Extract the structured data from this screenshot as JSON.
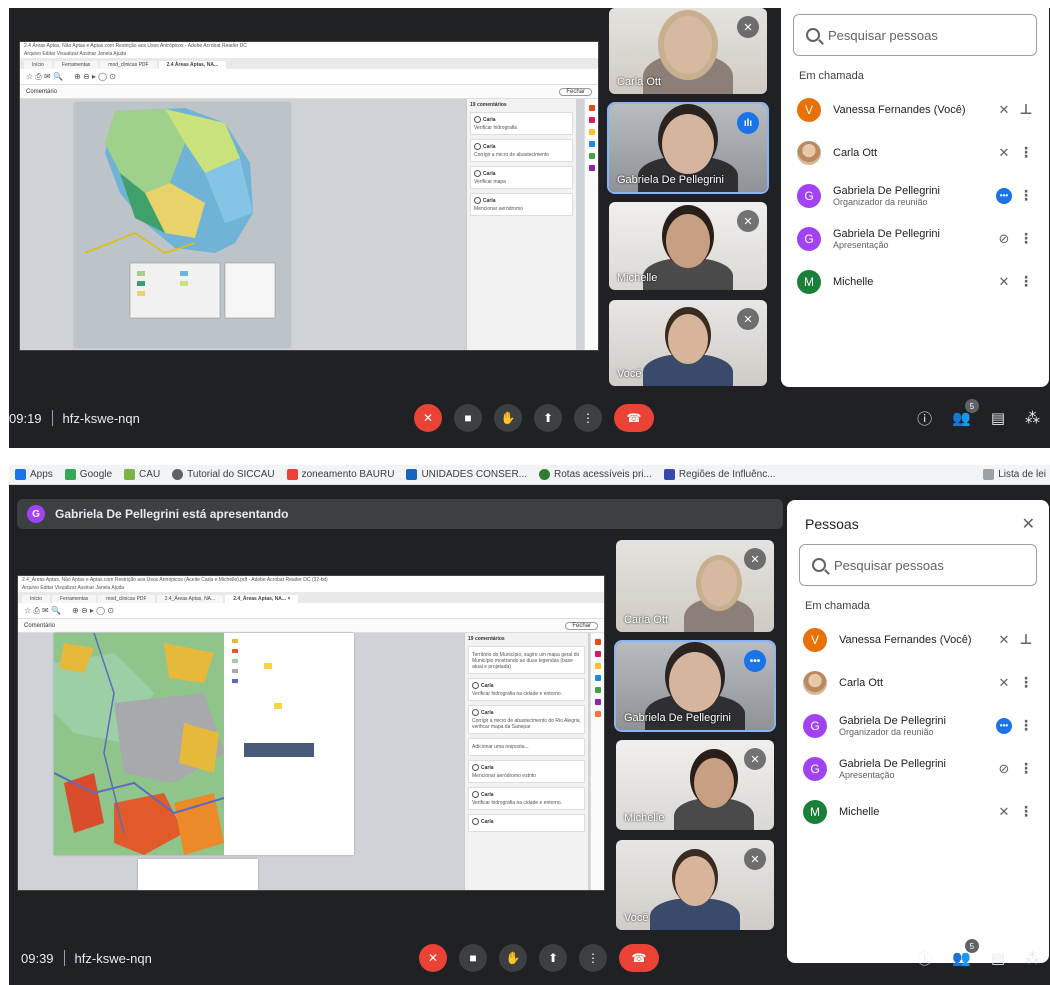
{
  "top": {
    "time": "09:19",
    "code": "hfz-kswe-nqn",
    "participant_count": "5",
    "search_placeholder": "Pesquisar pessoas",
    "in_call_label": "Em chamada",
    "tiles": [
      "Carla Ott",
      "Gabriela De Pellegrini",
      "Michelle",
      "Você"
    ],
    "people": [
      {
        "initial": "V",
        "name": "Vanessa Fernandes (Você)",
        "role": "",
        "color": "#e8710a"
      },
      {
        "initial": "",
        "name": "Carla Ott",
        "role": "",
        "color": "#b88a62"
      },
      {
        "initial": "G",
        "name": "Gabriela De Pellegrini",
        "role": "Organizador da reunião",
        "color": "#a142f4"
      },
      {
        "initial": "G",
        "name": "Gabriela De Pellegrini",
        "role": "Apresentação",
        "color": "#a142f4"
      },
      {
        "initial": "M",
        "name": "Michelle",
        "role": "",
        "color": "#188038"
      }
    ]
  },
  "bottom": {
    "time": "09:39",
    "code": "hfz-kswe-nqn",
    "participant_count": "5",
    "banner_initial": "G",
    "banner_text": "Gabriela De Pellegrini está apresentando",
    "panel_title": "Pessoas",
    "search_placeholder": "Pesquisar pessoas",
    "in_call_label": "Em chamada",
    "tiles": [
      "Carla Ott",
      "Gabriela De Pellegrini",
      "Michelle",
      "Você"
    ],
    "bookmarks": [
      "Apps",
      "Google",
      "CAU",
      "Tutorial do SICCAU",
      "zoneamento BAURU",
      "UNIDADES CONSER...",
      "Rotas acessíveis pri...",
      "Regiões de Influênc..."
    ],
    "bookmark_right": "Lista de lei",
    "pdf_title": "2.4_Áreas Aptas, Não Aptas e Aptas com Restrição aos Usos Antrópicos (Aceite Carla e Michelle).pdf - Adobe Acrobat Reader DC (32-bit)",
    "pdf_menu": "Arquivo  Editar  Visualizar  Assinar  Janela  Ajuda",
    "pdf_tabs": [
      "Início",
      "Ferramentas",
      "mod_clinicas PDF",
      "2.4_Áreas Aptas, NA...",
      "2.4_Áreas Aptas, NA... ×"
    ],
    "pdf_comment_label": "Comentário",
    "pdf_close_label": "Fechar",
    "comments_header": "19 comentários",
    "comments": [
      {
        "author": "",
        "text": "Território do Município, sugiro um mapa geral do Município mostrando as duas legendas (base atual e projetada)"
      },
      {
        "author": "Carla",
        "text": "Verificar hidrografia na cidade e entorno."
      },
      {
        "author": "Carla",
        "text": "Corrigir a micro de abastecimento do Rio Alegria, verificar mapa da Sanepar"
      },
      {
        "author": "",
        "text": "Adicionar uma resposta..."
      },
      {
        "author": "Carla",
        "text": "Mencionar aeródromo estrito"
      },
      {
        "author": "Carla",
        "text": "Verificar hidrografia na cidade e entorno."
      },
      {
        "author": "Carla",
        "text": ""
      }
    ],
    "people": [
      {
        "initial": "V",
        "name": "Vanessa Fernandes (Você)",
        "role": "",
        "color": "#e8710a"
      },
      {
        "initial": "",
        "name": "Carla Ott",
        "role": "",
        "color": "#b88a62"
      },
      {
        "initial": "G",
        "name": "Gabriela De Pellegrini",
        "role": "Organizador da reunião",
        "color": "#a142f4"
      },
      {
        "initial": "G",
        "name": "Gabriela De Pellegrini",
        "role": "Apresentação",
        "color": "#a142f4"
      },
      {
        "initial": "M",
        "name": "Michelle",
        "role": "",
        "color": "#188038"
      }
    ]
  }
}
